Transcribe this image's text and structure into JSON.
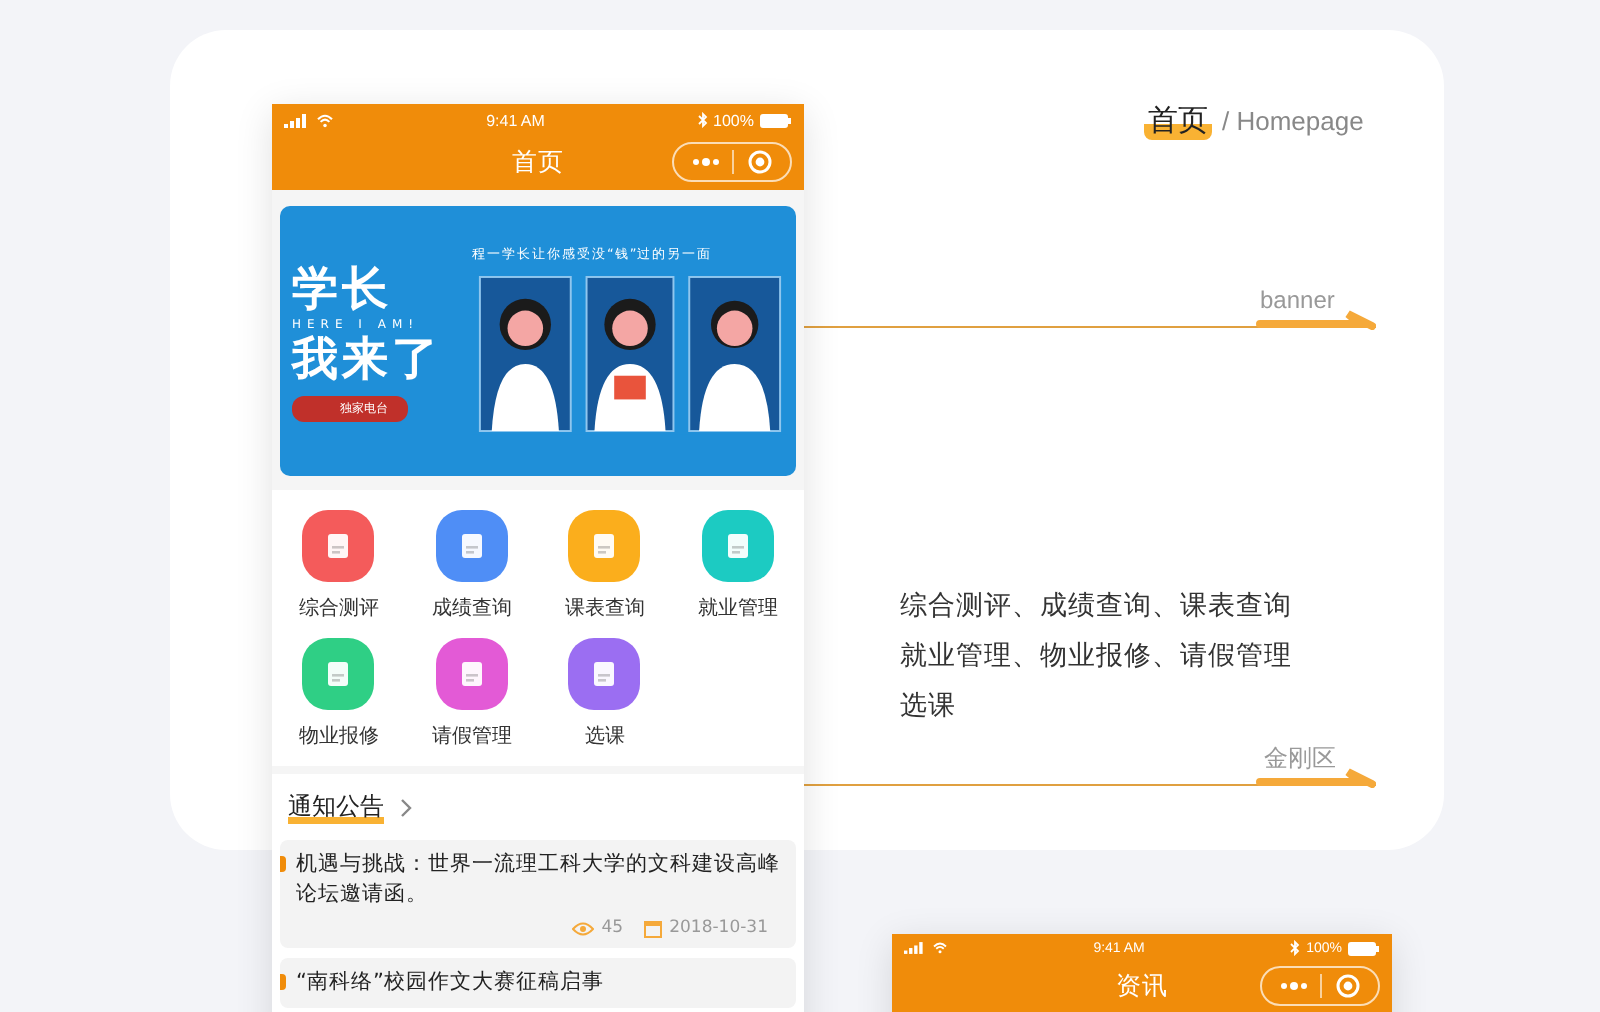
{
  "phones": [
    {
      "status": {
        "time": "9:41 AM",
        "battery": "100%"
      },
      "title": "首页",
      "banner": {
        "slogan": "程一学长让你感受没“钱”过的另一面",
        "title": "学长",
        "subtitle": "HERE I AM!",
        "title_2": "我来了",
        "badge": "独家电台"
      },
      "grid": [
        {
          "label": "综合测评",
          "color": "#f45b5b"
        },
        {
          "label": "成绩查询",
          "color": "#4f8ef6"
        },
        {
          "label": "课表查询",
          "color": "#fbae1c"
        },
        {
          "label": "就业管理",
          "color": "#1ccbc2"
        },
        {
          "label": "物业报修",
          "color": "#2fcf85"
        },
        {
          "label": "请假管理",
          "color": "#e35ad6"
        },
        {
          "label": "选课",
          "color": "#9b6ef2"
        }
      ],
      "notice_heading": "通知公告",
      "notices": [
        {
          "title": "机遇与挑战：世界一流理工科大学的文科建设高峰论坛邀请函。",
          "views": "45",
          "date": "2018-10-31"
        },
        {
          "title": "“南科络”校园作文大赛征稿启事"
        }
      ]
    },
    {
      "status": {
        "time": "9:41 AM",
        "battery": "100%"
      },
      "title": "资讯"
    }
  ],
  "annotations": {
    "heading": "首页",
    "heading_en": "/ Homepage",
    "banner_label": "banner",
    "summary": [
      "综合测评、成绩查询、课表查询",
      "就业管理、物业报修、请假管理",
      "选课"
    ],
    "grid_label": "金刚区"
  }
}
